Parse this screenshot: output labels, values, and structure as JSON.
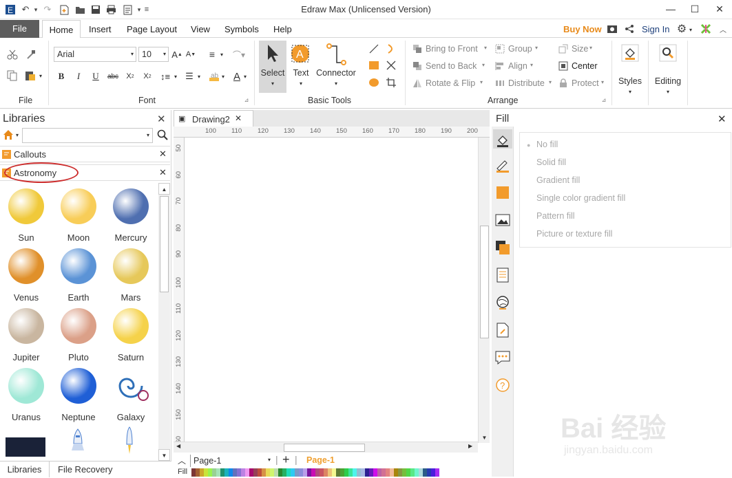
{
  "window": {
    "title": "Edraw Max (Unlicensed Version)"
  },
  "menu": {
    "file": "File",
    "tabs": [
      "Home",
      "Insert",
      "Page Layout",
      "View",
      "Symbols",
      "Help"
    ],
    "buy_now": "Buy Now",
    "sign_in": "Sign In"
  },
  "ribbon": {
    "groups": {
      "file": "File",
      "font": "Font",
      "basic_tools": "Basic Tools",
      "arrange": "Arrange"
    },
    "font_name": "Arial",
    "font_size": "10",
    "select": "Select",
    "text": "Text",
    "connector": "Connector",
    "bring_to_front": "Bring to Front",
    "send_to_back": "Send to Back",
    "rotate_flip": "Rotate & Flip",
    "group": "Group",
    "align": "Align",
    "distribute": "Distribute",
    "size": "Size",
    "center": "Center",
    "protect": "Protect",
    "styles": "Styles",
    "editing": "Editing"
  },
  "libraries": {
    "title": "Libraries",
    "search_placeholder": "",
    "sections": [
      "Callouts",
      "Astronomy"
    ],
    "items": [
      {
        "label": "Sun",
        "color": "#f0c93a"
      },
      {
        "label": "Moon",
        "color": "#f8cd58"
      },
      {
        "label": "Mercury",
        "color": "#4f6fb0"
      },
      {
        "label": "Venus",
        "color": "#e0902a"
      },
      {
        "label": "Earth",
        "color": "#5b93d6"
      },
      {
        "label": "Mars",
        "color": "#e6c85a"
      },
      {
        "label": "Jupiter",
        "color": "#c9b6a0"
      },
      {
        "label": "Pluto",
        "color": "#dba088"
      },
      {
        "label": "Saturn",
        "color": "#f5d24a"
      },
      {
        "label": "Uranus",
        "color": "#9fe8d6"
      },
      {
        "label": "Neptune",
        "color": "#1f5fd6"
      },
      {
        "label": "Galaxy",
        "color": "#2e6fb8"
      }
    ],
    "bottom_tabs": [
      "Libraries",
      "File Recovery"
    ]
  },
  "document": {
    "tab": "Drawing2",
    "ruler_h": [
      "100",
      "110",
      "120",
      "130",
      "140",
      "150",
      "160",
      "170",
      "180",
      "190",
      "200"
    ],
    "ruler_v": [
      "50",
      "60",
      "70",
      "80",
      "90",
      "100",
      "110",
      "120",
      "130",
      "140",
      "150",
      "60"
    ],
    "page_select": "Page-1",
    "page_tab": "Page-1",
    "fill_label": "Fill"
  },
  "fill_panel": {
    "title": "Fill",
    "options": [
      "No fill",
      "Solid fill",
      "Gradient fill",
      "Single color gradient fill",
      "Pattern fill",
      "Picture or texture fill"
    ]
  },
  "watermark": {
    "brand": "Bai 经验",
    "url": "jingyan.baidu.com"
  },
  "colors": {
    "accent": "#e88a1a",
    "file_tab": "#5d5d5d",
    "highlight": "#cc2b2b"
  }
}
